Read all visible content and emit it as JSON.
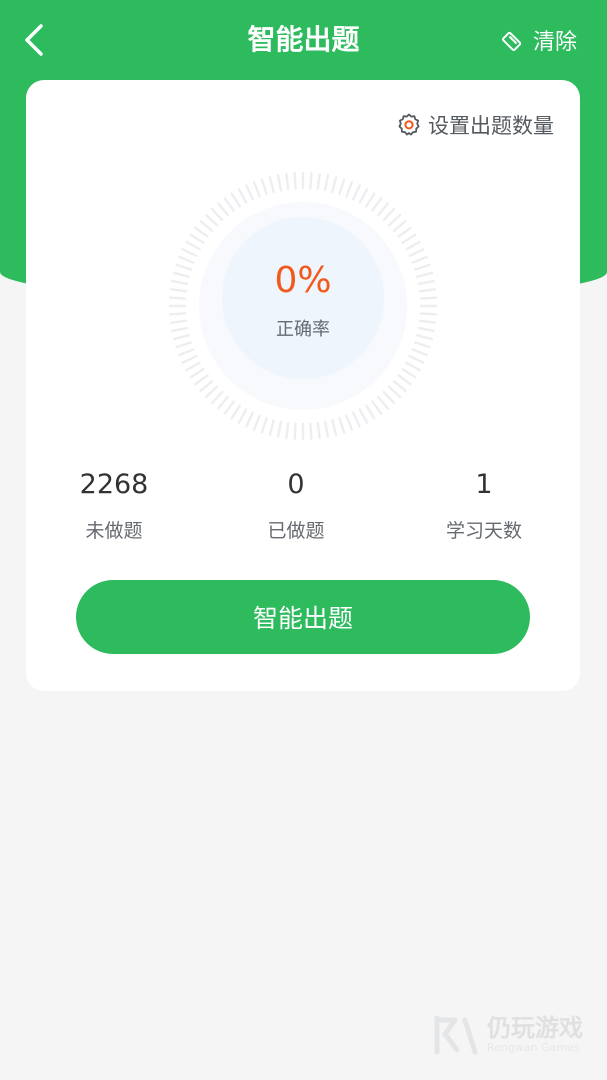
{
  "nav": {
    "title": "智能出题",
    "clear_label": "清除",
    "back_icon": "chevron-left-icon",
    "clear_icon": "eraser-icon"
  },
  "card": {
    "settings_label": "设置出题数量",
    "settings_icon": "gear-icon",
    "accuracy": {
      "value": "0%",
      "label": "正确率"
    },
    "stats": [
      {
        "value": "2268",
        "label": "未做题"
      },
      {
        "value": "0",
        "label": "已做题"
      },
      {
        "value": "1",
        "label": "学习天数"
      }
    ],
    "start_button_label": "智能出题"
  },
  "watermark": {
    "name": "仍玩游戏",
    "subtitle": "Rengwan Games"
  },
  "colors": {
    "brand_green": "#2dbb5e",
    "accuracy_orange": "#f25a1d",
    "background": "#f5f5f5",
    "gauge_center": "#eef5fd"
  }
}
